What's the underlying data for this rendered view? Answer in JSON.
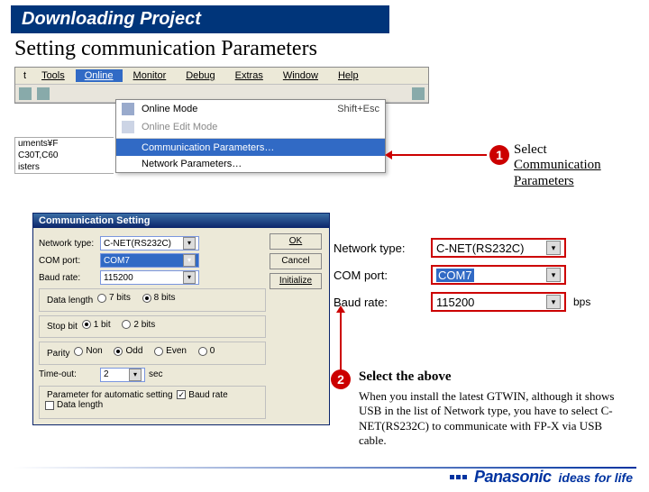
{
  "slide": {
    "title": "Downloading Project",
    "subtitle": "Setting communication Parameters"
  },
  "menubar": {
    "items": [
      "t",
      "Tools",
      "Online",
      "Monitor",
      "Debug",
      "Extras",
      "Window",
      "Help"
    ]
  },
  "dropdown": {
    "online_mode": "Online Mode",
    "online_mode_kbd": "Shift+Esc",
    "online_edit": "Online Edit Mode",
    "comm_params": "Communication Parameters…",
    "net_params": "Network Parameters…"
  },
  "sidebar_fragment": {
    "line1": "uments¥F",
    "line2": "C30T,C60",
    "line3": "isters"
  },
  "callout1": {
    "badge": "1",
    "lead": "Select",
    "link1": "Communication",
    "link2": "Parameters"
  },
  "dialog": {
    "title": "Communication Setting",
    "labels": {
      "network_type": "Network type:",
      "com_port": "COM port:",
      "baud_rate": "Baud rate:",
      "data_length": "Data length",
      "stop_bit": "Stop bit",
      "parity": "Parity",
      "timeout": "Time-out:",
      "auto": "Parameter for automatic setting",
      "auto_baud": "Baud rate",
      "auto_dl": "Data length"
    },
    "values": {
      "network_type": "C-NET(RS232C)",
      "com_port": "COM7",
      "baud_rate": "115200",
      "timeout_val": "2",
      "timeout_unit": "sec"
    },
    "radios": {
      "dl7": "7 bits",
      "dl8": "8 bits",
      "sb1": "1 bit",
      "sb2": "2 bits",
      "pn": "Non",
      "po": "Odd",
      "pe": "Even",
      "p0": "0"
    },
    "buttons": {
      "ok": "OK",
      "cancel": "Cancel",
      "initialize": "Initialize"
    }
  },
  "detail": {
    "labels": {
      "network_type": "Network type:",
      "com_port": "COM port:",
      "baud_rate": "Baud rate:",
      "bps": "bps"
    },
    "values": {
      "network_type": "C-NET(RS232C)",
      "com_port": "COM7",
      "baud_rate": "115200"
    }
  },
  "callout2": {
    "badge": "2",
    "text": "Select the above"
  },
  "note": "When you install the latest GTWIN, although it shows USB in the list of Network type, you have to select C-NET(RS232C) to communicate with FP-X via USB cable.",
  "footer": {
    "brand": "Panasonic",
    "tag": "ideas for life"
  }
}
